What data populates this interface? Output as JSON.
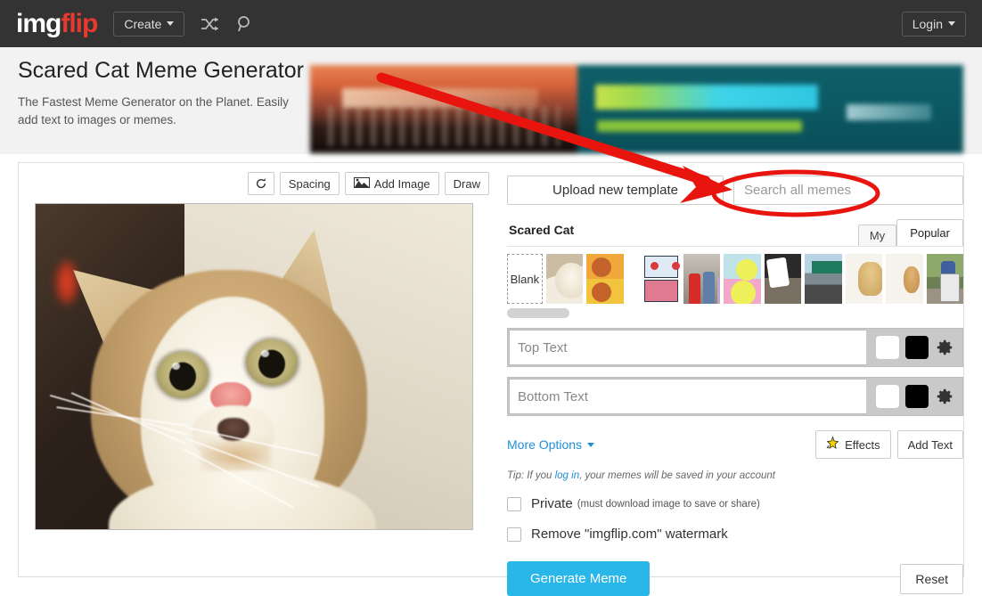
{
  "navbar": {
    "logo_img": "img",
    "logo_flip": "flip",
    "create_label": "Create",
    "shuffle_icon": "shuffle-icon",
    "search_icon": "search-icon",
    "login_label": "Login"
  },
  "header": {
    "title": "Scared Cat Meme Generator",
    "subtitle": "The Fastest Meme Generator on the Planet. Easily add text to images or memes.",
    "ad_brand_text": "LIONSGATE"
  },
  "toolbar": {
    "rotate_icon": "rotate-icon",
    "spacing_label": "Spacing",
    "add_image_label": "Add Image",
    "add_image_icon": "image-icon",
    "draw_label": "Draw"
  },
  "panel": {
    "upload_label": "Upload new template",
    "search_placeholder": "Search all memes",
    "search_value": "",
    "template_name": "Scared Cat",
    "tabs": [
      {
        "label": "My",
        "active": false
      },
      {
        "label": "Popular",
        "active": true
      }
    ],
    "blank_label": "Blank",
    "thumbnails": [
      {
        "name": "thumb-scared-cat",
        "art": "t-cat"
      },
      {
        "name": "thumb-drake",
        "art": "t-drake"
      },
      {
        "name": "thumb-two-panel-comic",
        "art": "t-comic"
      },
      {
        "name": "thumb-distracted-boyfriend",
        "art": "t-bf"
      },
      {
        "name": "thumb-pink-cartoon",
        "art": "t-pink"
      },
      {
        "name": "thumb-uno-draw-25",
        "art": "t-uno"
      },
      {
        "name": "thumb-highway-exit",
        "art": "t-exit"
      },
      {
        "name": "thumb-buff-doge",
        "art": "t-doge"
      },
      {
        "name": "thumb-cheems",
        "art": "t-cheems"
      },
      {
        "name": "thumb-trash-can",
        "art": "t-trash"
      }
    ]
  },
  "text_fields": [
    {
      "name": "top-text",
      "placeholder": "Top Text",
      "value": "",
      "fill_color": "#ffffff",
      "outline_color": "#000000",
      "gear_icon": "gear-icon"
    },
    {
      "name": "bottom-text",
      "placeholder": "Bottom Text",
      "value": "",
      "fill_color": "#ffffff",
      "outline_color": "#000000",
      "gear_icon": "gear-icon"
    }
  ],
  "options": {
    "more_options_label": "More Options",
    "effects_label": "Effects",
    "effects_icon": "sparkle-icon",
    "add_text_label": "Add Text",
    "tip_prefix": "Tip: If you ",
    "tip_link": "log in",
    "tip_suffix": ", your memes will be saved in your account"
  },
  "checkboxes": [
    {
      "name": "private-checkbox",
      "label": "Private",
      "hint": "(must download image to save or share)",
      "checked": false
    },
    {
      "name": "remove-watermark-checkbox",
      "label": "Remove \"imgflip.com\" watermark",
      "hint": "",
      "checked": false
    }
  ],
  "actions": {
    "generate_label": "Generate Meme",
    "generate_color": "#29b6e8",
    "reset_label": "Reset"
  },
  "annotation": {
    "color": "#e8150f",
    "arrow_name": "red-arrow-annotation",
    "ellipse_name": "red-ellipse-annotation"
  }
}
